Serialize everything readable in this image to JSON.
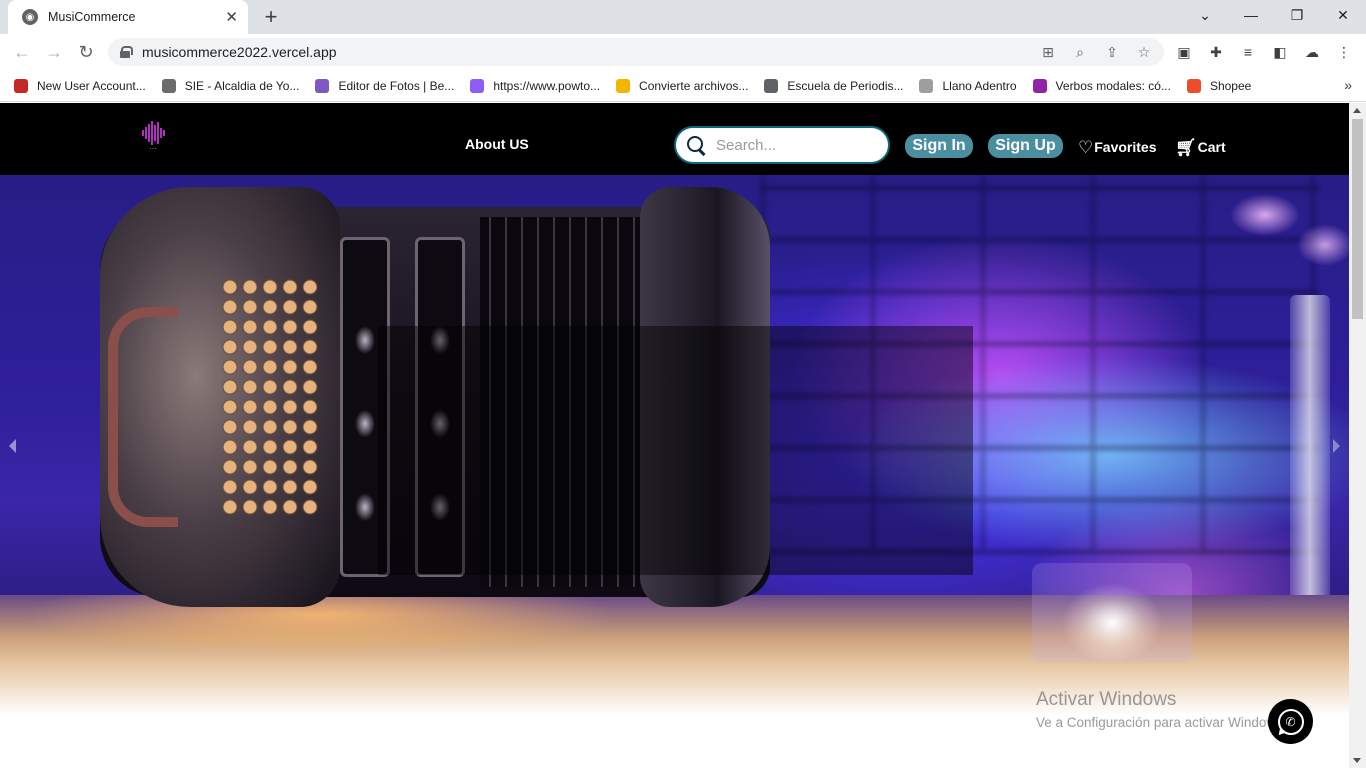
{
  "browser": {
    "tab_title": "MusiCommerce",
    "tab_close": "✕",
    "new_tab": "+",
    "url": "musicommerce2022.vercel.app",
    "window_controls": {
      "dropdown": "⌄",
      "minimize": "—",
      "restore": "❐",
      "close": "✕"
    },
    "bookmarks": [
      {
        "label": "New User Account...",
        "icon": "gear-red-icon",
        "color": "#c62828"
      },
      {
        "label": "SIE - Alcaldia de Yo...",
        "icon": "s-icon",
        "color": "#6b6b6b"
      },
      {
        "label": "Editor de Fotos | Be...",
        "icon": "rainbow-circle-icon",
        "color": "#7e57c2"
      },
      {
        "label": "https://www.powto...",
        "icon": "powtoon-icon",
        "color": "#8e5cf7"
      },
      {
        "label": "Convierte archivos...",
        "icon": "convert-icon",
        "color": "#f4b400"
      },
      {
        "label": "Escuela de Periodis...",
        "icon": "globe-icon",
        "color": "#5f6368"
      },
      {
        "label": "Llano Adentro",
        "icon": "page-icon",
        "color": "#9e9e9e"
      },
      {
        "label": "Verbos modales: có...",
        "icon": "quote-icon",
        "color": "#8e24aa"
      },
      {
        "label": "Shopee",
        "icon": "shopee-icon",
        "color": "#ee4d2d"
      }
    ],
    "bookmarks_more": "»"
  },
  "site": {
    "nav": {
      "about": "About US",
      "search_placeholder": "Search...",
      "sign_in": "Sign In",
      "sign_up": "Sign Up",
      "favorites": "Favorites",
      "cart": "Cart"
    },
    "colors": {
      "nav_bg": "#000000",
      "pill_bg": "#4a8ea0",
      "logo": "#b12fc0"
    },
    "hero": {
      "carousel": "accordion-photo"
    }
  },
  "os_watermark": {
    "title": "Activar Windows",
    "subtitle": "Ve a Configuración para activar Windows."
  }
}
